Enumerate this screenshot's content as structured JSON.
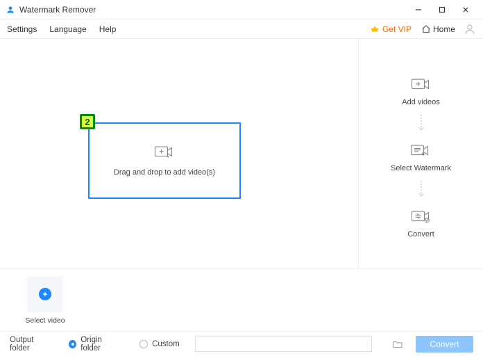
{
  "titlebar": {
    "title": "Watermark Remover"
  },
  "menubar": {
    "items": [
      "Settings",
      "Language",
      "Help"
    ],
    "vip_label": "Get VIP",
    "home_label": "Home"
  },
  "dropzone": {
    "label": "Drag and drop to add video(s)",
    "badge": "2"
  },
  "workflow": {
    "steps": [
      {
        "label": "Add videos"
      },
      {
        "label": "Select Watermark"
      },
      {
        "label": "Convert"
      }
    ]
  },
  "carousel": {
    "select_video_label": "Select video"
  },
  "footer": {
    "output_label": "Output folder",
    "origin_label": "Origin folder",
    "custom_label": "Custom",
    "path_value": "",
    "convert_label": "Convert"
  }
}
